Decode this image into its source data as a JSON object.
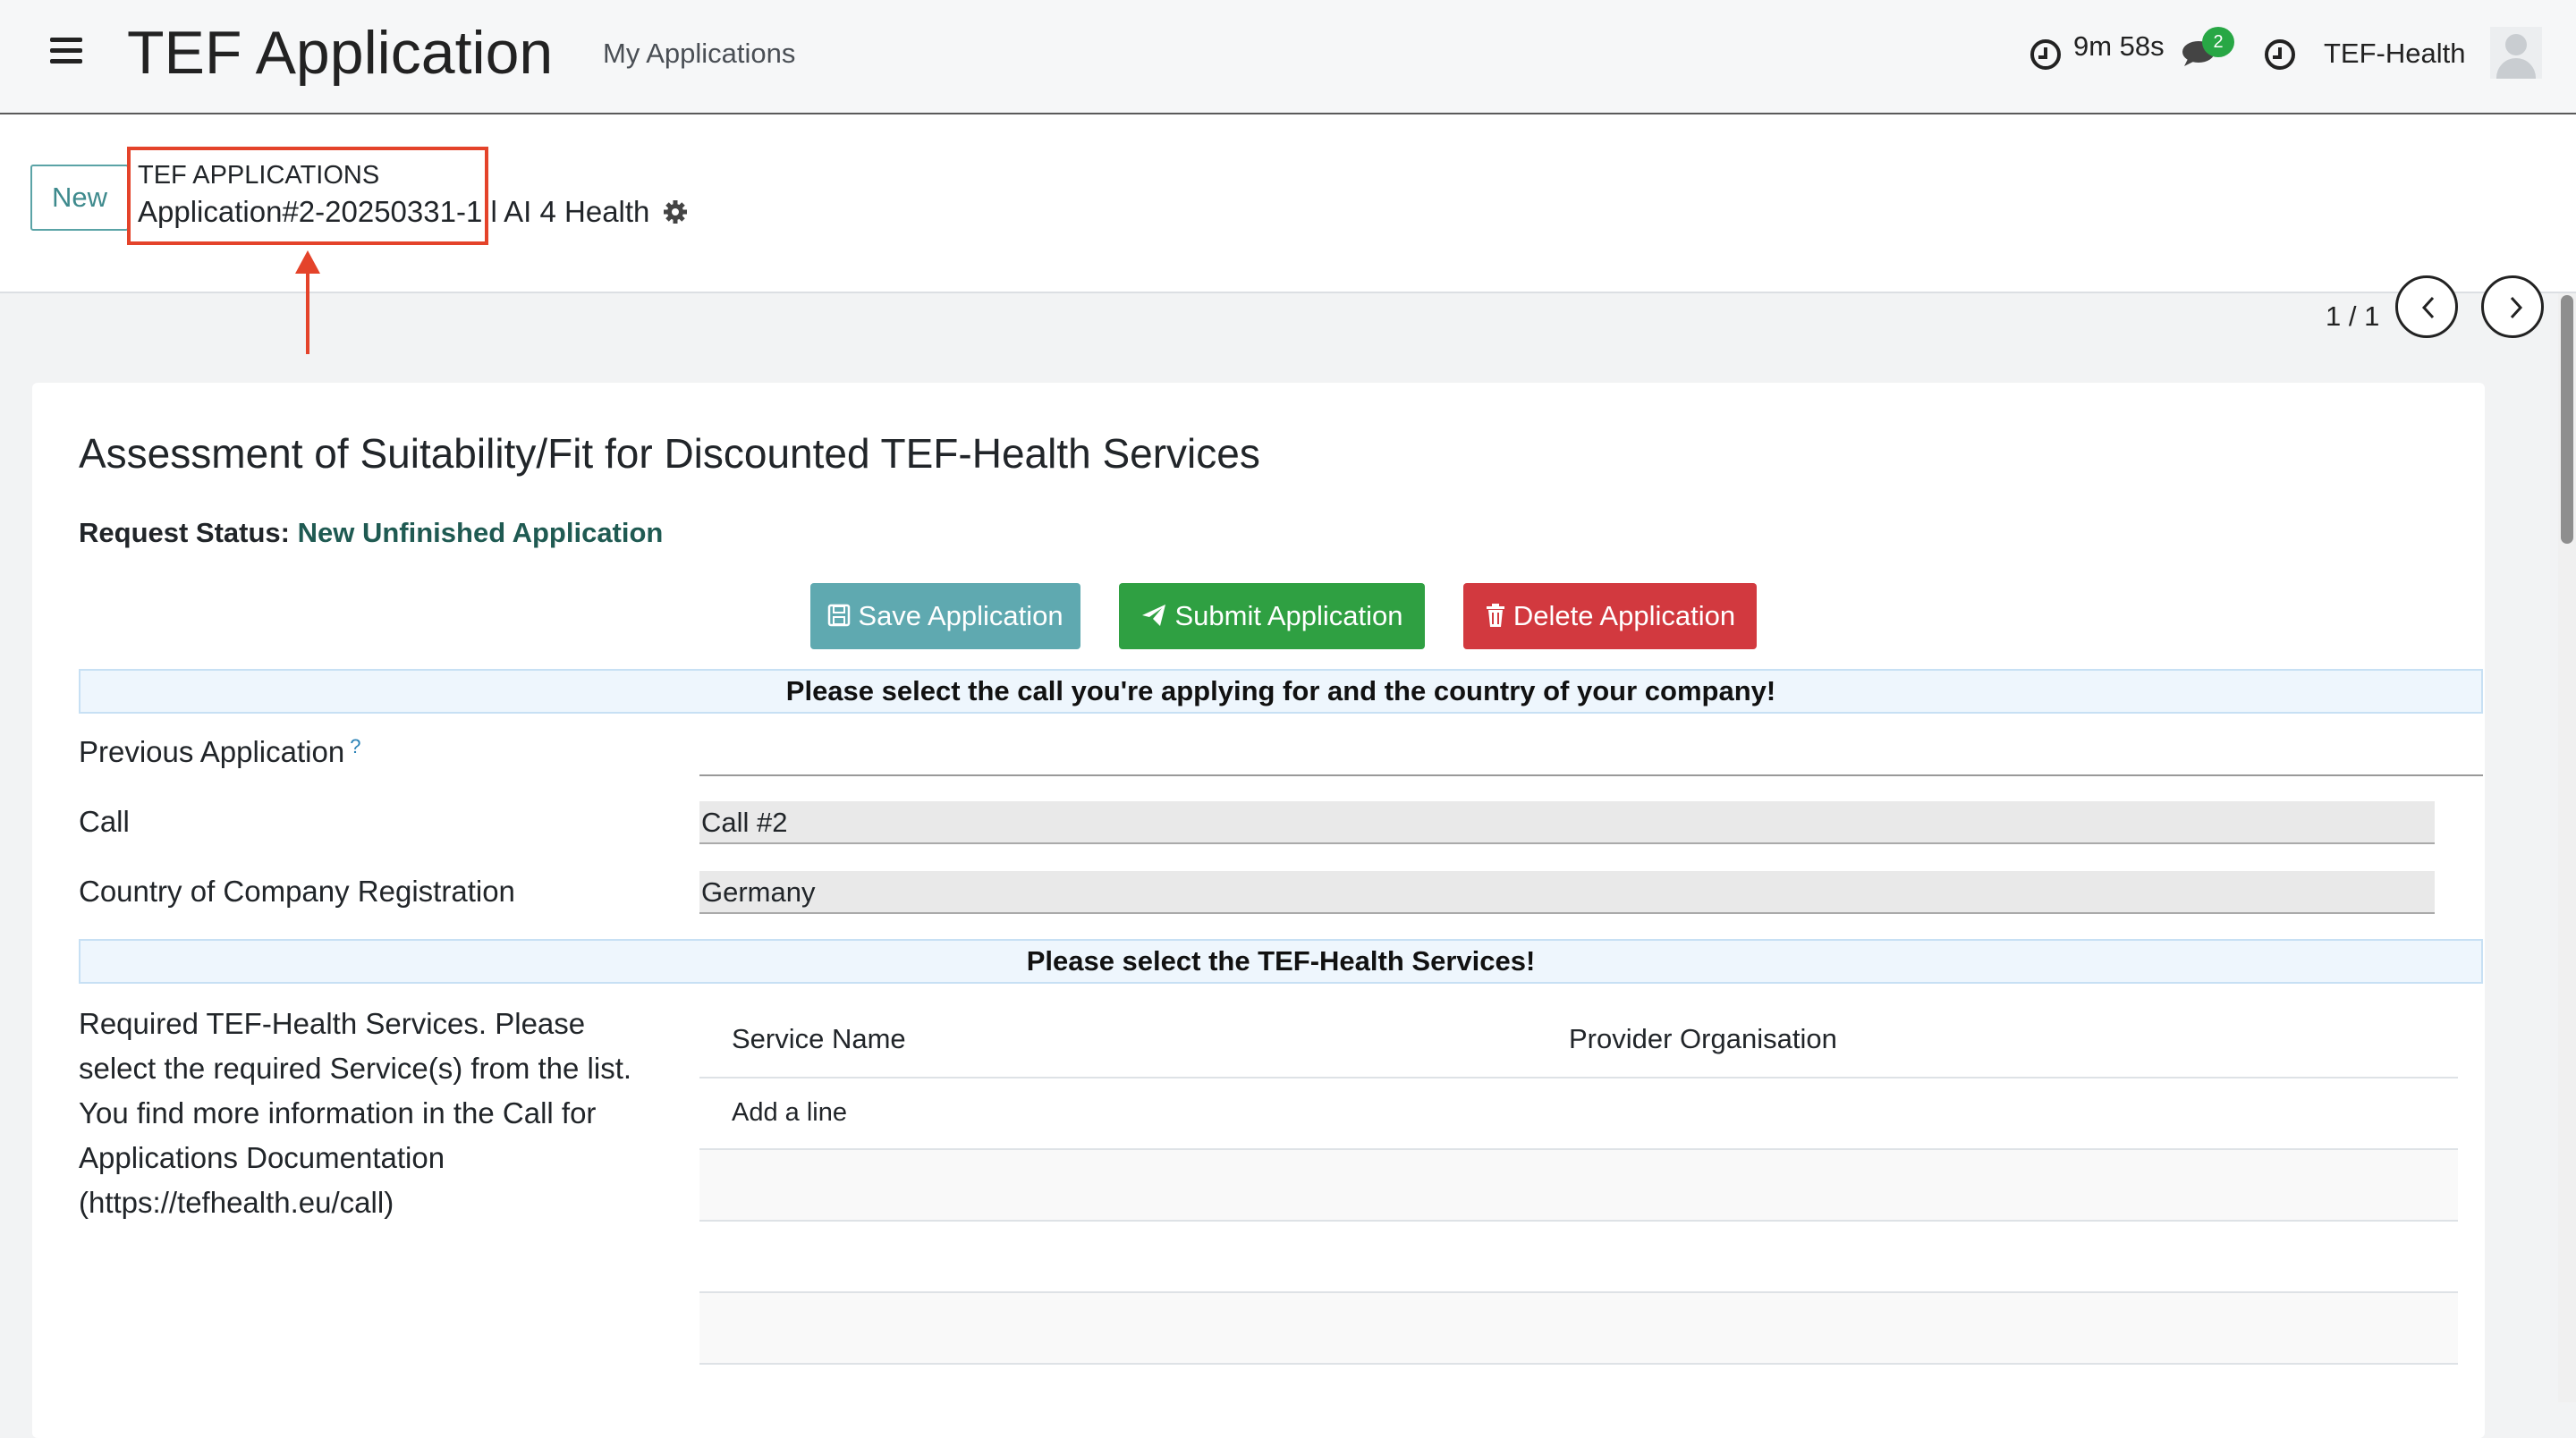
{
  "navbar": {
    "app_title": "TEF Application",
    "menu_link": "My Applications",
    "timer": "9m 58s",
    "chat_badge": "2",
    "company": "TEF-Health"
  },
  "control_panel": {
    "new_button": "New",
    "breadcrumb_parent": "TEF APPLICATIONS",
    "breadcrumb_current": "Application#2-20250331-1 l AI 4 Health",
    "pager": "1 / 1"
  },
  "form": {
    "title": "Assessment of Suitability/Fit for Discounted TEF-Health Services",
    "status_label": "Request Status:",
    "status_value": "New Unfinished Application",
    "buttons": {
      "save": "Save Application",
      "submit": "Submit Application",
      "delete": "Delete Application"
    },
    "banner_call": "Please select the call you're applying for and the country of your company!",
    "fields": {
      "previous_application": {
        "label": "Previous Application",
        "help": "?",
        "value": ""
      },
      "call": {
        "label": "Call",
        "value": "Call #2"
      },
      "country": {
        "label": "Country of Company Registration",
        "value": "Germany"
      }
    },
    "banner_services": "Please select the TEF-Health Services!",
    "services_description": "Required TEF-Health Services. Please select the required Service(s) from the list. You find more information in the Call for Applications Documentation (https://tefhealth.eu/call)",
    "services_table": {
      "columns": [
        "Service Name",
        "Provider Organisation"
      ],
      "add_line": "Add a line"
    }
  },
  "colors": {
    "annotation": "#e4432a",
    "save": "#5fa9b0",
    "submit": "#2fa042",
    "delete": "#d2393f",
    "status_value": "#1f5a52"
  },
  "icons": [
    "menu-icon",
    "clock-icon",
    "chat-icon",
    "gear-icon",
    "chevron-left-icon",
    "chevron-right-icon",
    "save-icon",
    "paper-plane-icon",
    "trash-icon",
    "user-avatar-icon"
  ]
}
